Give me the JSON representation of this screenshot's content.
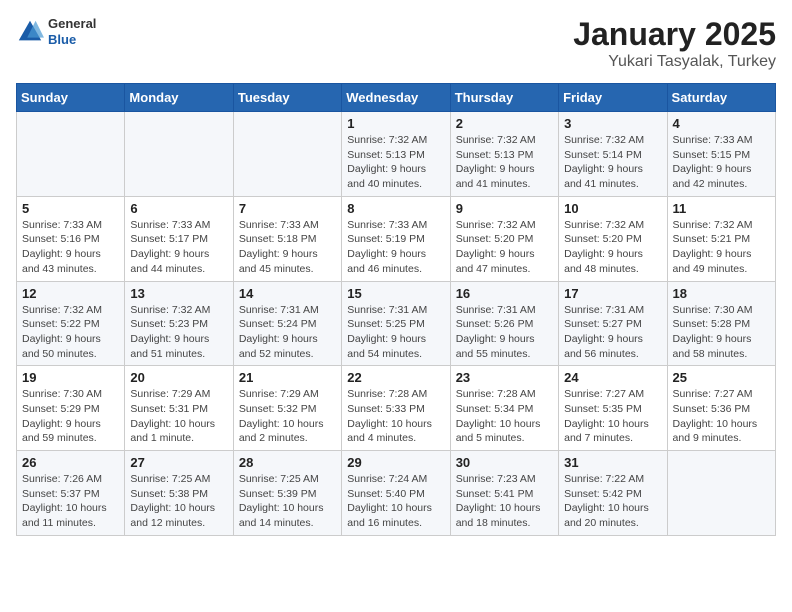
{
  "logo": {
    "general": "General",
    "blue": "Blue"
  },
  "title": "January 2025",
  "subtitle": "Yukari Tasyalak, Turkey",
  "days_of_week": [
    "Sunday",
    "Monday",
    "Tuesday",
    "Wednesday",
    "Thursday",
    "Friday",
    "Saturday"
  ],
  "weeks": [
    [
      {
        "day": "",
        "info": ""
      },
      {
        "day": "",
        "info": ""
      },
      {
        "day": "",
        "info": ""
      },
      {
        "day": "1",
        "info": "Sunrise: 7:32 AM\nSunset: 5:13 PM\nDaylight: 9 hours\nand 40 minutes."
      },
      {
        "day": "2",
        "info": "Sunrise: 7:32 AM\nSunset: 5:13 PM\nDaylight: 9 hours\nand 41 minutes."
      },
      {
        "day": "3",
        "info": "Sunrise: 7:32 AM\nSunset: 5:14 PM\nDaylight: 9 hours\nand 41 minutes."
      },
      {
        "day": "4",
        "info": "Sunrise: 7:33 AM\nSunset: 5:15 PM\nDaylight: 9 hours\nand 42 minutes."
      }
    ],
    [
      {
        "day": "5",
        "info": "Sunrise: 7:33 AM\nSunset: 5:16 PM\nDaylight: 9 hours\nand 43 minutes."
      },
      {
        "day": "6",
        "info": "Sunrise: 7:33 AM\nSunset: 5:17 PM\nDaylight: 9 hours\nand 44 minutes."
      },
      {
        "day": "7",
        "info": "Sunrise: 7:33 AM\nSunset: 5:18 PM\nDaylight: 9 hours\nand 45 minutes."
      },
      {
        "day": "8",
        "info": "Sunrise: 7:33 AM\nSunset: 5:19 PM\nDaylight: 9 hours\nand 46 minutes."
      },
      {
        "day": "9",
        "info": "Sunrise: 7:32 AM\nSunset: 5:20 PM\nDaylight: 9 hours\nand 47 minutes."
      },
      {
        "day": "10",
        "info": "Sunrise: 7:32 AM\nSunset: 5:20 PM\nDaylight: 9 hours\nand 48 minutes."
      },
      {
        "day": "11",
        "info": "Sunrise: 7:32 AM\nSunset: 5:21 PM\nDaylight: 9 hours\nand 49 minutes."
      }
    ],
    [
      {
        "day": "12",
        "info": "Sunrise: 7:32 AM\nSunset: 5:22 PM\nDaylight: 9 hours\nand 50 minutes."
      },
      {
        "day": "13",
        "info": "Sunrise: 7:32 AM\nSunset: 5:23 PM\nDaylight: 9 hours\nand 51 minutes."
      },
      {
        "day": "14",
        "info": "Sunrise: 7:31 AM\nSunset: 5:24 PM\nDaylight: 9 hours\nand 52 minutes."
      },
      {
        "day": "15",
        "info": "Sunrise: 7:31 AM\nSunset: 5:25 PM\nDaylight: 9 hours\nand 54 minutes."
      },
      {
        "day": "16",
        "info": "Sunrise: 7:31 AM\nSunset: 5:26 PM\nDaylight: 9 hours\nand 55 minutes."
      },
      {
        "day": "17",
        "info": "Sunrise: 7:31 AM\nSunset: 5:27 PM\nDaylight: 9 hours\nand 56 minutes."
      },
      {
        "day": "18",
        "info": "Sunrise: 7:30 AM\nSunset: 5:28 PM\nDaylight: 9 hours\nand 58 minutes."
      }
    ],
    [
      {
        "day": "19",
        "info": "Sunrise: 7:30 AM\nSunset: 5:29 PM\nDaylight: 9 hours\nand 59 minutes."
      },
      {
        "day": "20",
        "info": "Sunrise: 7:29 AM\nSunset: 5:31 PM\nDaylight: 10 hours\nand 1 minute."
      },
      {
        "day": "21",
        "info": "Sunrise: 7:29 AM\nSunset: 5:32 PM\nDaylight: 10 hours\nand 2 minutes."
      },
      {
        "day": "22",
        "info": "Sunrise: 7:28 AM\nSunset: 5:33 PM\nDaylight: 10 hours\nand 4 minutes."
      },
      {
        "day": "23",
        "info": "Sunrise: 7:28 AM\nSunset: 5:34 PM\nDaylight: 10 hours\nand 5 minutes."
      },
      {
        "day": "24",
        "info": "Sunrise: 7:27 AM\nSunset: 5:35 PM\nDaylight: 10 hours\nand 7 minutes."
      },
      {
        "day": "25",
        "info": "Sunrise: 7:27 AM\nSunset: 5:36 PM\nDaylight: 10 hours\nand 9 minutes."
      }
    ],
    [
      {
        "day": "26",
        "info": "Sunrise: 7:26 AM\nSunset: 5:37 PM\nDaylight: 10 hours\nand 11 minutes."
      },
      {
        "day": "27",
        "info": "Sunrise: 7:25 AM\nSunset: 5:38 PM\nDaylight: 10 hours\nand 12 minutes."
      },
      {
        "day": "28",
        "info": "Sunrise: 7:25 AM\nSunset: 5:39 PM\nDaylight: 10 hours\nand 14 minutes."
      },
      {
        "day": "29",
        "info": "Sunrise: 7:24 AM\nSunset: 5:40 PM\nDaylight: 10 hours\nand 16 minutes."
      },
      {
        "day": "30",
        "info": "Sunrise: 7:23 AM\nSunset: 5:41 PM\nDaylight: 10 hours\nand 18 minutes."
      },
      {
        "day": "31",
        "info": "Sunrise: 7:22 AM\nSunset: 5:42 PM\nDaylight: 10 hours\nand 20 minutes."
      },
      {
        "day": "",
        "info": ""
      }
    ]
  ]
}
